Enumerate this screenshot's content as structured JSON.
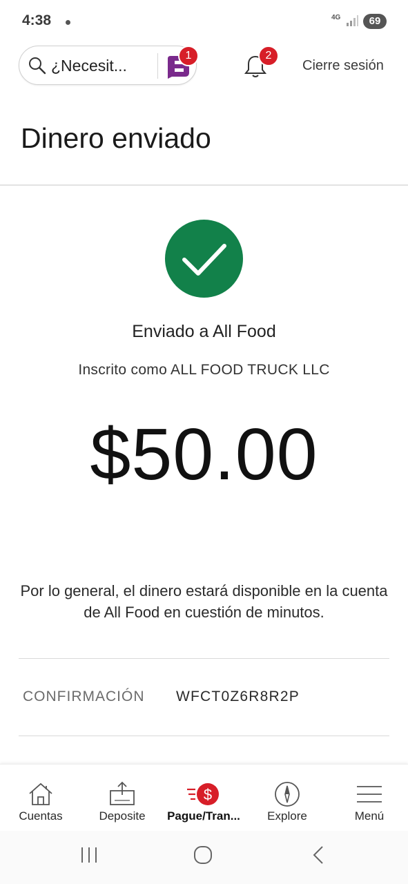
{
  "status": {
    "time": "4:38",
    "network": "4G",
    "battery": "69"
  },
  "header": {
    "search_placeholder": "¿Necesit...",
    "fargo_badge": "1",
    "notifications_badge": "2",
    "logout_label": "Cierre sesión"
  },
  "page": {
    "title": "Dinero enviado"
  },
  "confirmation": {
    "sent_to": "Enviado a All Food",
    "enrolled_as": "Inscrito como ALL FOOD TRUCK LLC",
    "amount": "$50.00",
    "info_text": "Por lo general, el dinero estará disponible en la cuenta de All Food en cuestión de minutos.",
    "label": "CONFIRMACIÓN",
    "code": "WFCT0Z6R8R2P"
  },
  "tabs": [
    {
      "label": "Cuentas",
      "icon": "home-icon"
    },
    {
      "label": "Deposite",
      "icon": "deposit-icon"
    },
    {
      "label": "Pague/Tran...",
      "icon": "pay-transfer-icon",
      "active": true
    },
    {
      "label": "Explore",
      "icon": "compass-icon"
    },
    {
      "label": "Menú",
      "icon": "hamburger-menu-icon"
    }
  ],
  "colors": {
    "success_green": "#12814a",
    "badge_red": "#d71e28",
    "fargo_purple": "#7a2a8c"
  }
}
